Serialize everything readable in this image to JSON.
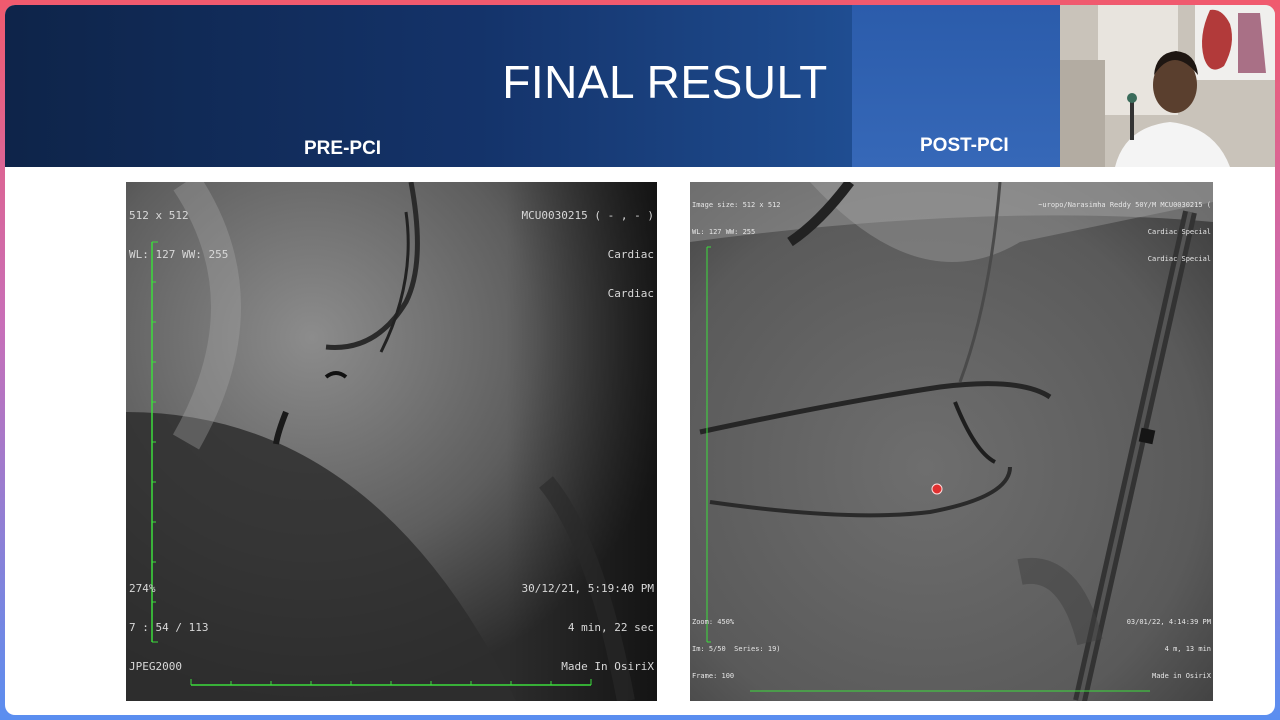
{
  "slide": {
    "title": "FINAL RESULT",
    "left_label": "PRE-PCI",
    "right_label": "POST-PCI"
  },
  "pre_pci_image": {
    "top_left": [
      "512 x 512",
      "WL: 127 WW: 255"
    ],
    "top_right": [
      "MCU0030215 ( - , - )",
      "Cardiac",
      "Cardiac"
    ],
    "bottom_left": [
      "274%",
      "7 : 54 / 113",
      "JPEG2000"
    ],
    "bottom_right": [
      "30/12/21, 5:19:40 PM",
      "4 min, 22 sec",
      "Made In OsiriX"
    ]
  },
  "post_pci_image": {
    "top_left": [
      "Image size: 512 x 512",
      "WL: 127 WW: 255"
    ],
    "top_right": [
      "~uropo/Narasimha Reddy 50Y/M MCU0030215 (",
      "Cardiac Special",
      "Cardiac Special"
    ],
    "bottom_left": [
      "Zoom: 450%",
      "Im: 5/50  Series: 19)",
      "Frame: 100"
    ],
    "bottom_right": [
      "03/01/22, 4:14:39 PM",
      "4 m, 13 min",
      "Made in OsiriX"
    ]
  },
  "colors": {
    "banner_dark": "#0e2449",
    "banner_light": "#3668b8",
    "ruler_green": "#3cdc3c",
    "marker_red": "#e03030"
  }
}
